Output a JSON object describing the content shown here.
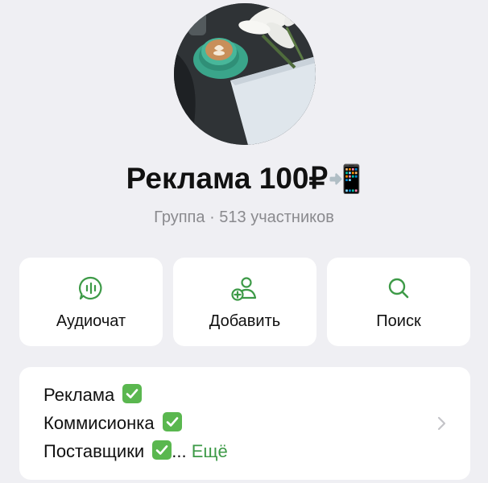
{
  "header": {
    "title": "Реклама 100₽",
    "title_emoji": "📲",
    "subtitle": "Группа · 513 участников"
  },
  "actions": [
    {
      "label": "Аудиочат",
      "icon": "audio-chat-icon"
    },
    {
      "label": "Добавить",
      "icon": "add-user-icon"
    },
    {
      "label": "Поиск",
      "icon": "search-icon"
    }
  ],
  "description": {
    "lines": [
      "Реклама",
      "Коммисионка",
      "Поставщики"
    ],
    "ellipsis": "...",
    "more_label": "Ещё"
  },
  "colors": {
    "accent": "#3d9a47",
    "background": "#efeff3",
    "card": "#ffffff",
    "check": "#5ab74f"
  }
}
